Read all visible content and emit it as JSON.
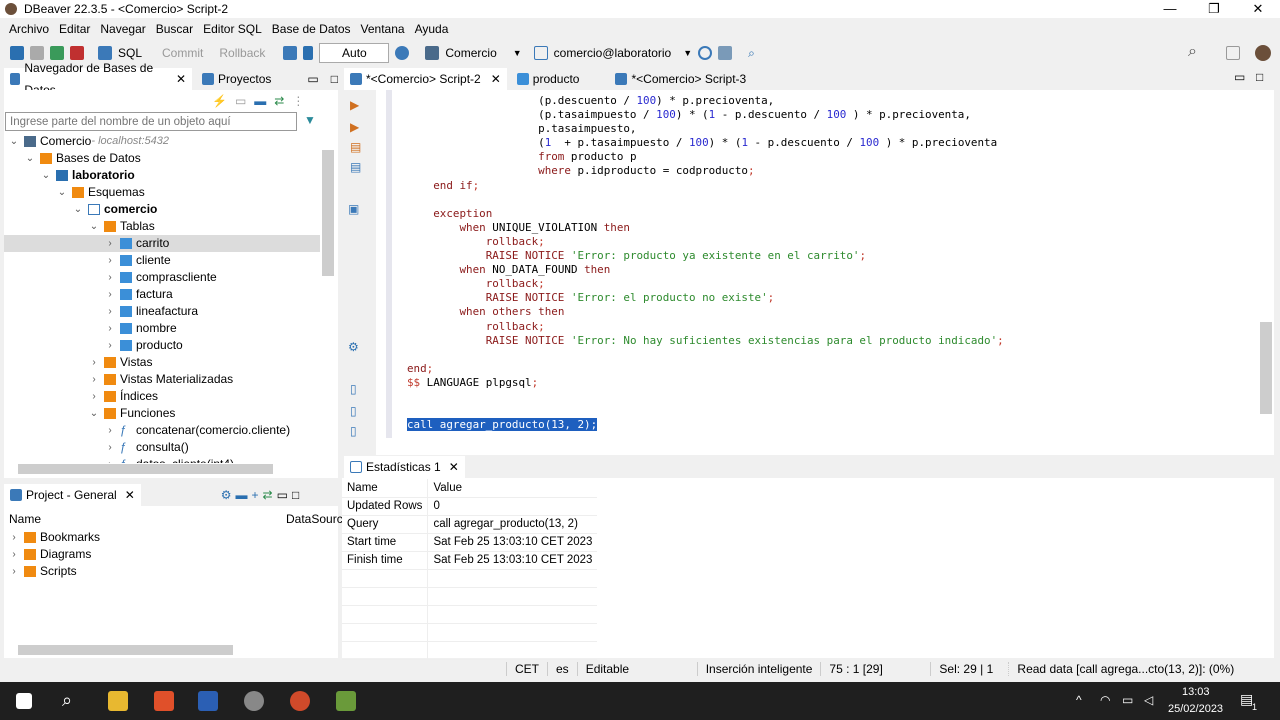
{
  "window": {
    "title": "DBeaver 22.3.5 - <Comercio> Script-2",
    "controls": [
      "—",
      "❐",
      "✕"
    ]
  },
  "menu": [
    "Archivo",
    "Editar",
    "Navegar",
    "Buscar",
    "Editor SQL",
    "Base de Datos",
    "Ventana",
    "Ayuda"
  ],
  "toolbar": {
    "sql": "SQL",
    "commit": "Commit",
    "rollback": "Rollback",
    "mode": "Auto",
    "datasource": "Comercio",
    "schema": "comercio@laboratorio"
  },
  "left_tabs": [
    "Navegador de Bases de Datos",
    "Proyectos"
  ],
  "editor_tabs": [
    "*<Comercio> Script-2",
    "producto",
    "*<Comercio> Script-3"
  ],
  "navigator": {
    "filter_placeholder": "Ingrese parte del nombre de un objeto aquí",
    "tree": [
      {
        "label": "Comercio",
        "sub": " - localhost:5432",
        "depth": 0,
        "open": true,
        "icon": "connection-icon"
      },
      {
        "label": "Bases de Datos",
        "depth": 1,
        "open": true,
        "icon": "folder-icon"
      },
      {
        "label": "laboratorio",
        "depth": 2,
        "open": true,
        "bold": true,
        "icon": "database-icon"
      },
      {
        "label": "Esquemas",
        "depth": 3,
        "open": true,
        "icon": "folder-icon"
      },
      {
        "label": "comercio",
        "depth": 4,
        "open": true,
        "bold": true,
        "icon": "schema-icon"
      },
      {
        "label": "Tablas",
        "depth": 5,
        "open": true,
        "icon": "folder-icon"
      },
      {
        "label": "carrito",
        "depth": 6,
        "icon": "table-icon",
        "selected": true
      },
      {
        "label": "cliente",
        "depth": 6,
        "icon": "table-icon"
      },
      {
        "label": "comprascliente",
        "depth": 6,
        "icon": "table-icon"
      },
      {
        "label": "factura",
        "depth": 6,
        "icon": "table-icon"
      },
      {
        "label": "lineafactura",
        "depth": 6,
        "icon": "table-icon"
      },
      {
        "label": "nombre",
        "depth": 6,
        "icon": "table-icon"
      },
      {
        "label": "producto",
        "depth": 6,
        "icon": "table-icon"
      },
      {
        "label": "Vistas",
        "depth": 5,
        "icon": "folder-icon"
      },
      {
        "label": "Vistas Materializadas",
        "depth": 5,
        "icon": "folder-icon"
      },
      {
        "label": "Índices",
        "depth": 5,
        "icon": "folder-icon"
      },
      {
        "label": "Funciones",
        "depth": 5,
        "open": true,
        "icon": "folder-icon"
      },
      {
        "label": "concatenar(comercio.cliente)",
        "depth": 6,
        "icon": "function-icon"
      },
      {
        "label": "consulta()",
        "depth": 6,
        "icon": "function-icon"
      },
      {
        "label": "datos_cliente(int4)",
        "depth": 6,
        "icon": "function-icon"
      }
    ]
  },
  "project": {
    "title": "Project - General",
    "columns": [
      "Name",
      "DataSource"
    ],
    "items": [
      "Bookmarks",
      "Diagrams",
      "Scripts"
    ]
  },
  "code": [
    [
      [
        "                    (p.descuento / ",
        ""
      ],
      [
        "100",
        "n"
      ],
      [
        ") * p.precioventa,",
        ""
      ]
    ],
    [
      [
        "                    (p.tasaimpuesto / ",
        ""
      ],
      [
        "100",
        "n"
      ],
      [
        ") * (",
        ""
      ],
      [
        "1",
        "n"
      ],
      [
        " - p.descuento / ",
        ""
      ],
      [
        "100",
        "n"
      ],
      [
        " ) * p.precioventa,",
        ""
      ]
    ],
    [
      [
        "                    p.tasaimpuesto,",
        ""
      ]
    ],
    [
      [
        "                    (",
        ""
      ],
      [
        "1",
        "n"
      ],
      [
        "  + p.tasaimpuesto / ",
        ""
      ],
      [
        "100",
        "n"
      ],
      [
        ") * (",
        ""
      ],
      [
        "1",
        "n"
      ],
      [
        " - p.descuento / ",
        ""
      ],
      [
        "100",
        "n"
      ],
      [
        " ) * p.precioventa",
        ""
      ]
    ],
    [
      [
        "                    ",
        ""
      ],
      [
        "from",
        "k"
      ],
      [
        " producto p",
        ""
      ]
    ],
    [
      [
        "                    ",
        ""
      ],
      [
        "where",
        "k"
      ],
      [
        " p.idproducto = codproducto",
        ""
      ],
      [
        ";",
        "p"
      ]
    ],
    [
      [
        "    ",
        ""
      ],
      [
        "end if",
        "k"
      ],
      [
        ";",
        "p"
      ]
    ],
    [],
    [
      [
        "    ",
        ""
      ],
      [
        "exception",
        "k"
      ]
    ],
    [
      [
        "        ",
        ""
      ],
      [
        "when",
        "k"
      ],
      [
        " UNIQUE_VIOLATION ",
        ""
      ],
      [
        "then",
        "k"
      ]
    ],
    [
      [
        "            ",
        ""
      ],
      [
        "rollback",
        "k"
      ],
      [
        ";",
        "p"
      ]
    ],
    [
      [
        "            ",
        ""
      ],
      [
        "RAISE NOTICE",
        "k"
      ],
      [
        " ",
        ""
      ],
      [
        "'Error: producto ya existente en el carrito'",
        "s"
      ],
      [
        ";",
        "p"
      ]
    ],
    [
      [
        "        ",
        ""
      ],
      [
        "when",
        "k"
      ],
      [
        " NO_DATA_FOUND ",
        ""
      ],
      [
        "then",
        "k"
      ]
    ],
    [
      [
        "            ",
        ""
      ],
      [
        "rollback",
        "k"
      ],
      [
        ";",
        "p"
      ]
    ],
    [
      [
        "            ",
        ""
      ],
      [
        "RAISE NOTICE",
        "k"
      ],
      [
        " ",
        ""
      ],
      [
        "'Error: el producto no existe'",
        "s"
      ],
      [
        ";",
        "p"
      ]
    ],
    [
      [
        "        ",
        ""
      ],
      [
        "when others then",
        "k"
      ]
    ],
    [
      [
        "            ",
        ""
      ],
      [
        "rollback",
        "k"
      ],
      [
        ";",
        "p"
      ]
    ],
    [
      [
        "            ",
        ""
      ],
      [
        "RAISE NOTICE",
        "k"
      ],
      [
        " ",
        ""
      ],
      [
        "'Error: No hay suficientes existencias para el producto indicado'",
        "s"
      ],
      [
        ";",
        "p"
      ]
    ],
    [],
    [
      [
        "end",
        "k"
      ],
      [
        ";",
        "p"
      ]
    ],
    [
      [
        "$$",
        "p"
      ],
      [
        " LANGUAGE ",
        ""
      ],
      [
        "plpgsql",
        ""
      ],
      [
        ";",
        "p"
      ]
    ],
    [],
    [],
    [
      [
        "call agregar_producto(13, 2);",
        "hl"
      ]
    ]
  ],
  "results": {
    "tab": "Estadísticas 1",
    "columns": [
      "Name",
      "Value"
    ],
    "rows": [
      [
        "Updated Rows",
        "0"
      ],
      [
        "Query",
        "call agregar_producto(13, 2)"
      ],
      [
        "Start time",
        "Sat Feb 25 13:03:10 CET 2023"
      ],
      [
        "Finish time",
        "Sat Feb 25 13:03:10 CET 2023"
      ]
    ]
  },
  "status": {
    "tz": "CET",
    "lang": "es",
    "mode": "Editable",
    "insert": "Inserción inteligente",
    "pos": "75 : 1 [29]",
    "sel": "Sel: 29 | 1",
    "task": "Read data [call agrega...cto(13, 2)]: (0%)"
  },
  "taskbar": {
    "time": "13:03",
    "date": "25/02/2023",
    "notifications": "1"
  }
}
